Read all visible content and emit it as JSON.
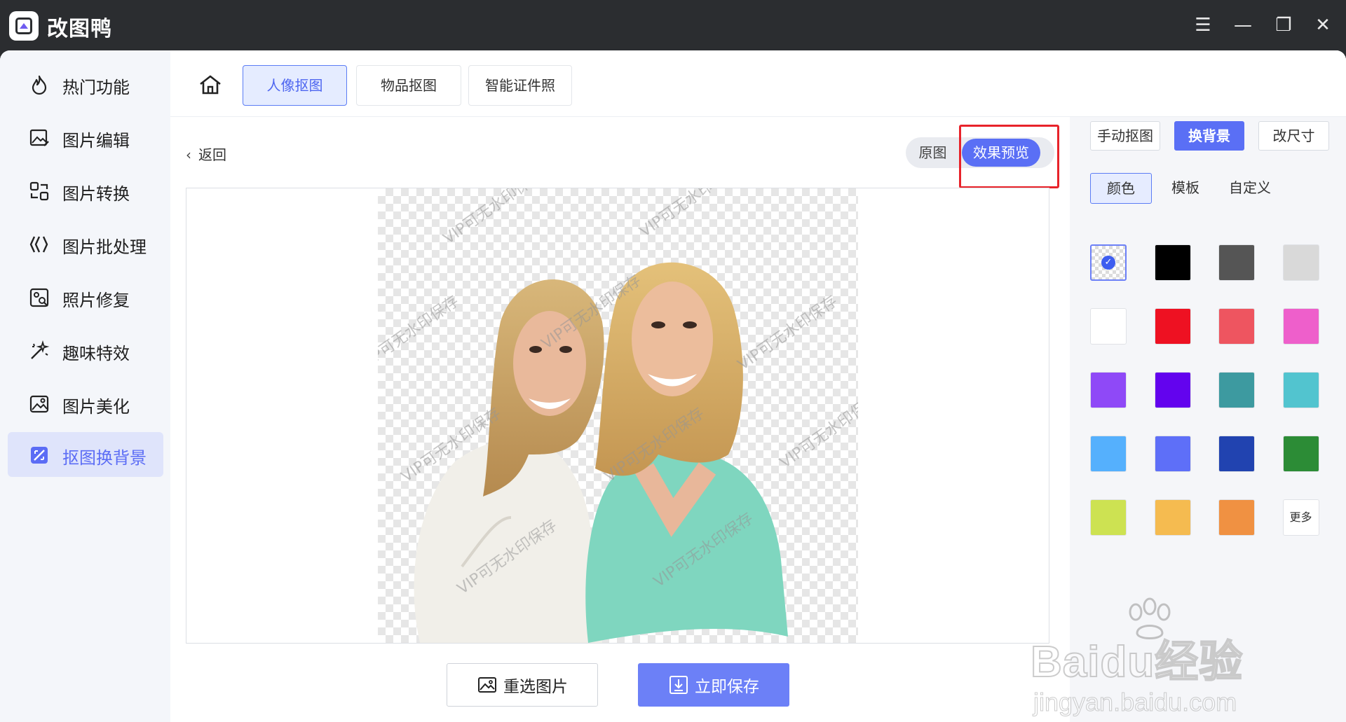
{
  "app": {
    "title": "改图鸭"
  },
  "window_controls": {
    "menu": "☰",
    "minimize": "—",
    "maximize": "❐",
    "close": "✕"
  },
  "sidebar": {
    "items": [
      {
        "label": "热门功能",
        "icon": "flame-icon",
        "active": false
      },
      {
        "label": "图片编辑",
        "icon": "image-edit-icon",
        "active": false
      },
      {
        "label": "图片转换",
        "icon": "convert-icon",
        "active": false
      },
      {
        "label": "图片批处理",
        "icon": "batch-icon",
        "active": false
      },
      {
        "label": "照片修复",
        "icon": "photo-repair-icon",
        "active": false
      },
      {
        "label": "趣味特效",
        "icon": "sparkle-icon",
        "active": false
      },
      {
        "label": "图片美化",
        "icon": "beautify-icon",
        "active": false
      },
      {
        "label": "抠图换背景",
        "icon": "cutout-icon",
        "active": true
      }
    ]
  },
  "topbar": {
    "home_icon": "home-icon",
    "tabs": [
      {
        "label": "人像抠图",
        "active": true
      },
      {
        "label": "物品抠图",
        "active": false
      },
      {
        "label": "智能证件照",
        "active": false
      }
    ]
  },
  "editor": {
    "back_label": "返回",
    "toggle": {
      "original": "原图",
      "preview": "效果预览"
    },
    "watermark_text": "VIP可无水印保存",
    "reselect_label": "重选图片",
    "save_label": "立即保存"
  },
  "right_panel": {
    "modes": [
      {
        "label": "手动抠图",
        "active": false
      },
      {
        "label": "换背景",
        "active": true
      },
      {
        "label": "改尺寸",
        "active": false
      }
    ],
    "subtabs": [
      {
        "label": "颜色",
        "active": true
      },
      {
        "label": "模板",
        "active": false
      },
      {
        "label": "自定义",
        "active": false
      }
    ],
    "swatches": [
      "transparent",
      "#000000",
      "#555555",
      "#d9d9d9",
      "#ffffff",
      "#ee1122",
      "#ee5560",
      "#ee5fcb",
      "#8f49f7",
      "#6303ee",
      "#3d9aa0",
      "#52c4cf",
      "#55b0fd",
      "#5e6ff8",
      "#2143b0",
      "#2c8c36",
      "#cde252",
      "#f5bb50",
      "#f09142",
      "more"
    ],
    "selected_swatch": 0,
    "more_label": "更多"
  },
  "site_watermark": {
    "brand": "Baidu经验",
    "url": "jingyan.baidu.com"
  },
  "colors": {
    "accent": "#5a6ff5",
    "highlight_box": "#e8232a",
    "titlebar": "#2b2d30"
  }
}
